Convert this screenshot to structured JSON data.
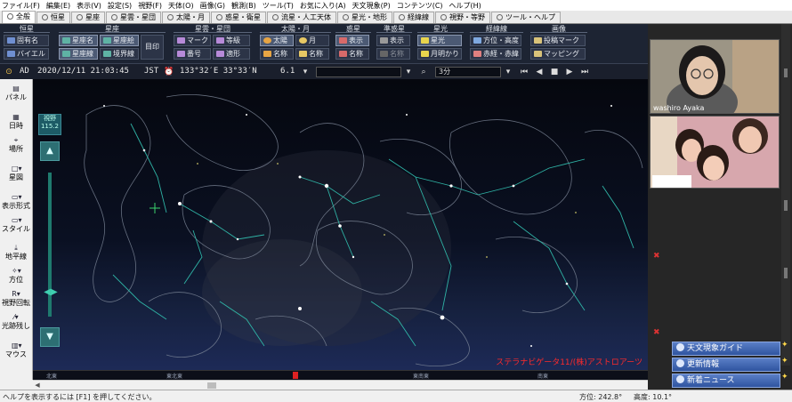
{
  "menu": [
    "ファイル(F)",
    "編集(E)",
    "表示(V)",
    "設定(S)",
    "視野(F)",
    "天体(O)",
    "画像(G)",
    "観測(B)",
    "ツール(T)",
    "お気に入り(A)",
    "天文現象(P)",
    "コンテンツ(C)",
    "ヘルプ(H)"
  ],
  "tabs": [
    "全般",
    "恒星",
    "星座",
    "星雲・星団",
    "太陽・月",
    "惑星・衛星",
    "流星・人工天体",
    "星光・地形",
    "経緯線",
    "視野・等野",
    "ツール・ヘルプ"
  ],
  "ribbon": {
    "groups": {
      "stars": "恒星",
      "constellations": "星座",
      "nebulae": "星雲・星団",
      "sunmoon": "太陽・月",
      "planets": "惑星",
      "minor": "準惑星",
      "glow": "星光",
      "grid": "経緯線",
      "image": "画像"
    },
    "buttons": {
      "proper_name": "固有名",
      "bayer": "バイエル",
      "const_name": "星座名",
      "const_line": "星座線",
      "const_picture": "星座絵",
      "boundary": "境界線",
      "mejirushi": "目印",
      "mark": "マーク",
      "catalog": "番号",
      "magnitude": "等級",
      "shape": "適形",
      "sun": "太陽",
      "moon": "月",
      "sun_name": "名称",
      "moon_name": "名称",
      "planet_show": "表示",
      "planet_name": "名称",
      "minor_show": "表示",
      "minor_name": "名称",
      "glow": "星光",
      "moonlight": "月明かり",
      "altaz": "方位・高度",
      "radec": "赤経・赤緯",
      "projection_mark": "投稿マーク",
      "mapping": "マッピング"
    }
  },
  "toolbar": {
    "ad": "AD",
    "datetime": "2020/12/11 21:03:45",
    "tz": "JST",
    "coords": "133°32′E 33°33′N",
    "mag": "6.1",
    "step": "3分"
  },
  "left_panel": [
    {
      "label": "パネル",
      "icon": "panel-icon"
    },
    {
      "label": "日時",
      "icon": "clock-icon"
    },
    {
      "label": "場所",
      "icon": "location-icon"
    },
    {
      "label": "星図",
      "icon": "star-map-icon"
    },
    {
      "label": "表示形式",
      "icon": "display-format-icon"
    },
    {
      "label": "スタイル",
      "icon": "style-icon"
    },
    {
      "label": "地平線",
      "icon": "horizon-icon"
    },
    {
      "label": "方位",
      "icon": "compass-icon"
    },
    {
      "label": "視野回転",
      "icon": "rotate-icon"
    },
    {
      "label": "光跡残し",
      "icon": "trail-icon"
    },
    {
      "label": "マウス",
      "icon": "mouse-icon"
    }
  ],
  "sky": {
    "fov_label": "視野",
    "fov_value": "115.2",
    "watermark": "ステラナビゲータ11/(株)アストロアーツ",
    "compass_labels": [
      "北東",
      "東北東",
      "東南東",
      "南東"
    ],
    "up_arrow": "▲",
    "down_arrow": "▼",
    "slider_thumb": "◀▶"
  },
  "status": {
    "help": "ヘルプを表示するには [F1] を押してください。",
    "azimuth": "方位: 242.8°",
    "altitude": "高度: 10.1°"
  },
  "video": {
    "name1": "washiro Ayaka"
  },
  "news": [
    {
      "label": "天文現象ガイド",
      "icon": "guide-icon"
    },
    {
      "label": "更新情報",
      "icon": "update-icon"
    },
    {
      "label": "新着ニュース",
      "icon": "info-icon"
    }
  ]
}
